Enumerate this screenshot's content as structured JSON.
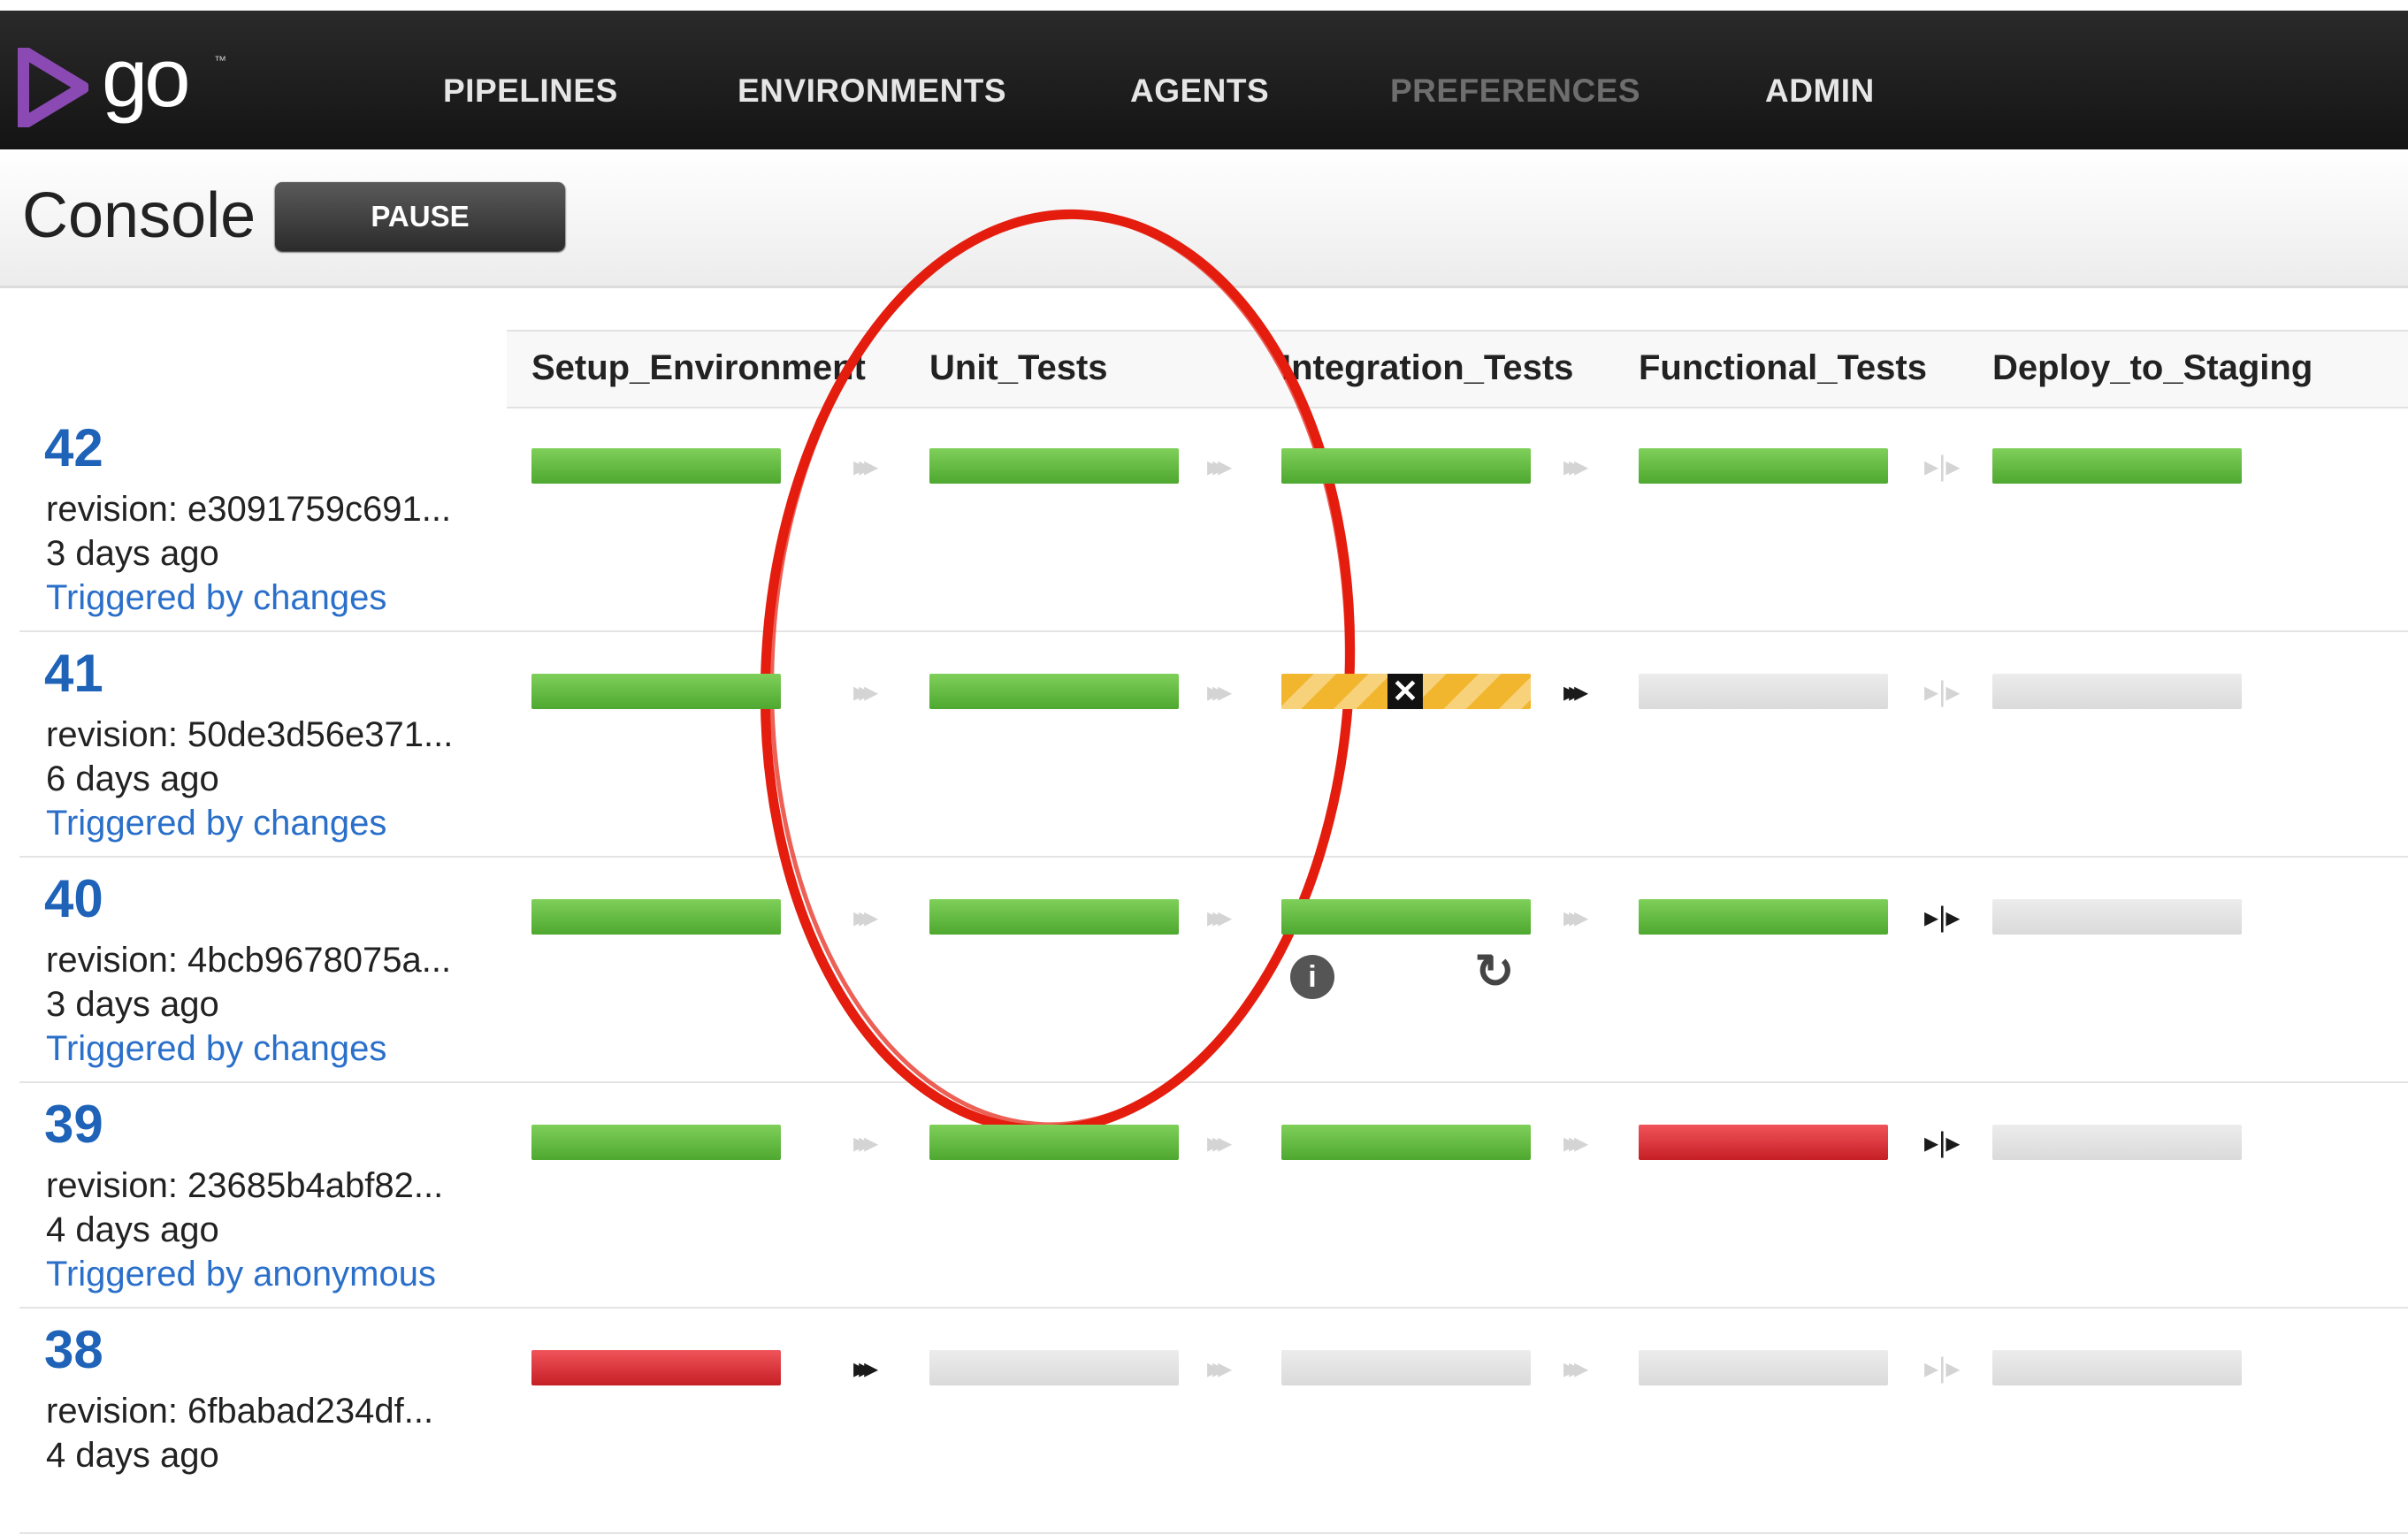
{
  "nav": {
    "logo_text": "go",
    "items": [
      "PIPELINES",
      "ENVIRONMENTS",
      "AGENTS",
      "PREFERENCES",
      "ADMIN"
    ]
  },
  "header": {
    "title": "Console",
    "pause_label": "PAUSE"
  },
  "stages": [
    "Setup_Environment",
    "Unit_Tests",
    "Integration_Tests",
    "Functional_Tests",
    "Deploy_to_Staging"
  ],
  "colors": {
    "passed": "#5cb83a",
    "failed": "#d9313a",
    "building": "#f2b52e",
    "pending": "#e0e0e0",
    "link": "#2a6fc9",
    "run_label": "#1f63b8",
    "annotation": "#e41d0e"
  },
  "runs": [
    {
      "label": "42",
      "revision": "revision: e3091759c691...",
      "time": "3 days ago",
      "trigger": "Triggered by changes",
      "stage_status": [
        "passed",
        "passed",
        "passed",
        "passed",
        "passed"
      ],
      "transitions": [
        "auto",
        "auto",
        "auto",
        "manual"
      ]
    },
    {
      "label": "41",
      "revision": "revision: 50de3d56e371...",
      "time": "6 days ago",
      "trigger": "Triggered by changes",
      "stage_status": [
        "passed",
        "passed",
        "building",
        "pending",
        "pending"
      ],
      "transitions": [
        "auto",
        "auto",
        "auto-active",
        "manual"
      ]
    },
    {
      "label": "40",
      "revision": "revision: 4bcb9678075a...",
      "time": "3 days ago",
      "trigger": "Triggered by changes",
      "stage_status": [
        "passed",
        "passed",
        "passed",
        "passed",
        "pending"
      ],
      "transitions": [
        "auto",
        "auto",
        "auto",
        "manual-active"
      ],
      "icons": [
        "info-icon",
        "rerun-icon"
      ]
    },
    {
      "label": "39",
      "revision": "revision: 23685b4abf82...",
      "time": "4 days ago",
      "trigger": "Triggered by anonymous",
      "stage_status": [
        "passed",
        "passed",
        "passed",
        "failed",
        "pending"
      ],
      "transitions": [
        "auto",
        "auto",
        "auto",
        "manual-active"
      ]
    },
    {
      "label": "38",
      "revision": "revision: 6fbabad234df...",
      "time": "4 days ago",
      "trigger": "",
      "stage_status": [
        "failed",
        "pending",
        "pending",
        "pending",
        "pending"
      ],
      "transitions": [
        "auto-active",
        "auto",
        "auto",
        "manual"
      ]
    }
  ]
}
